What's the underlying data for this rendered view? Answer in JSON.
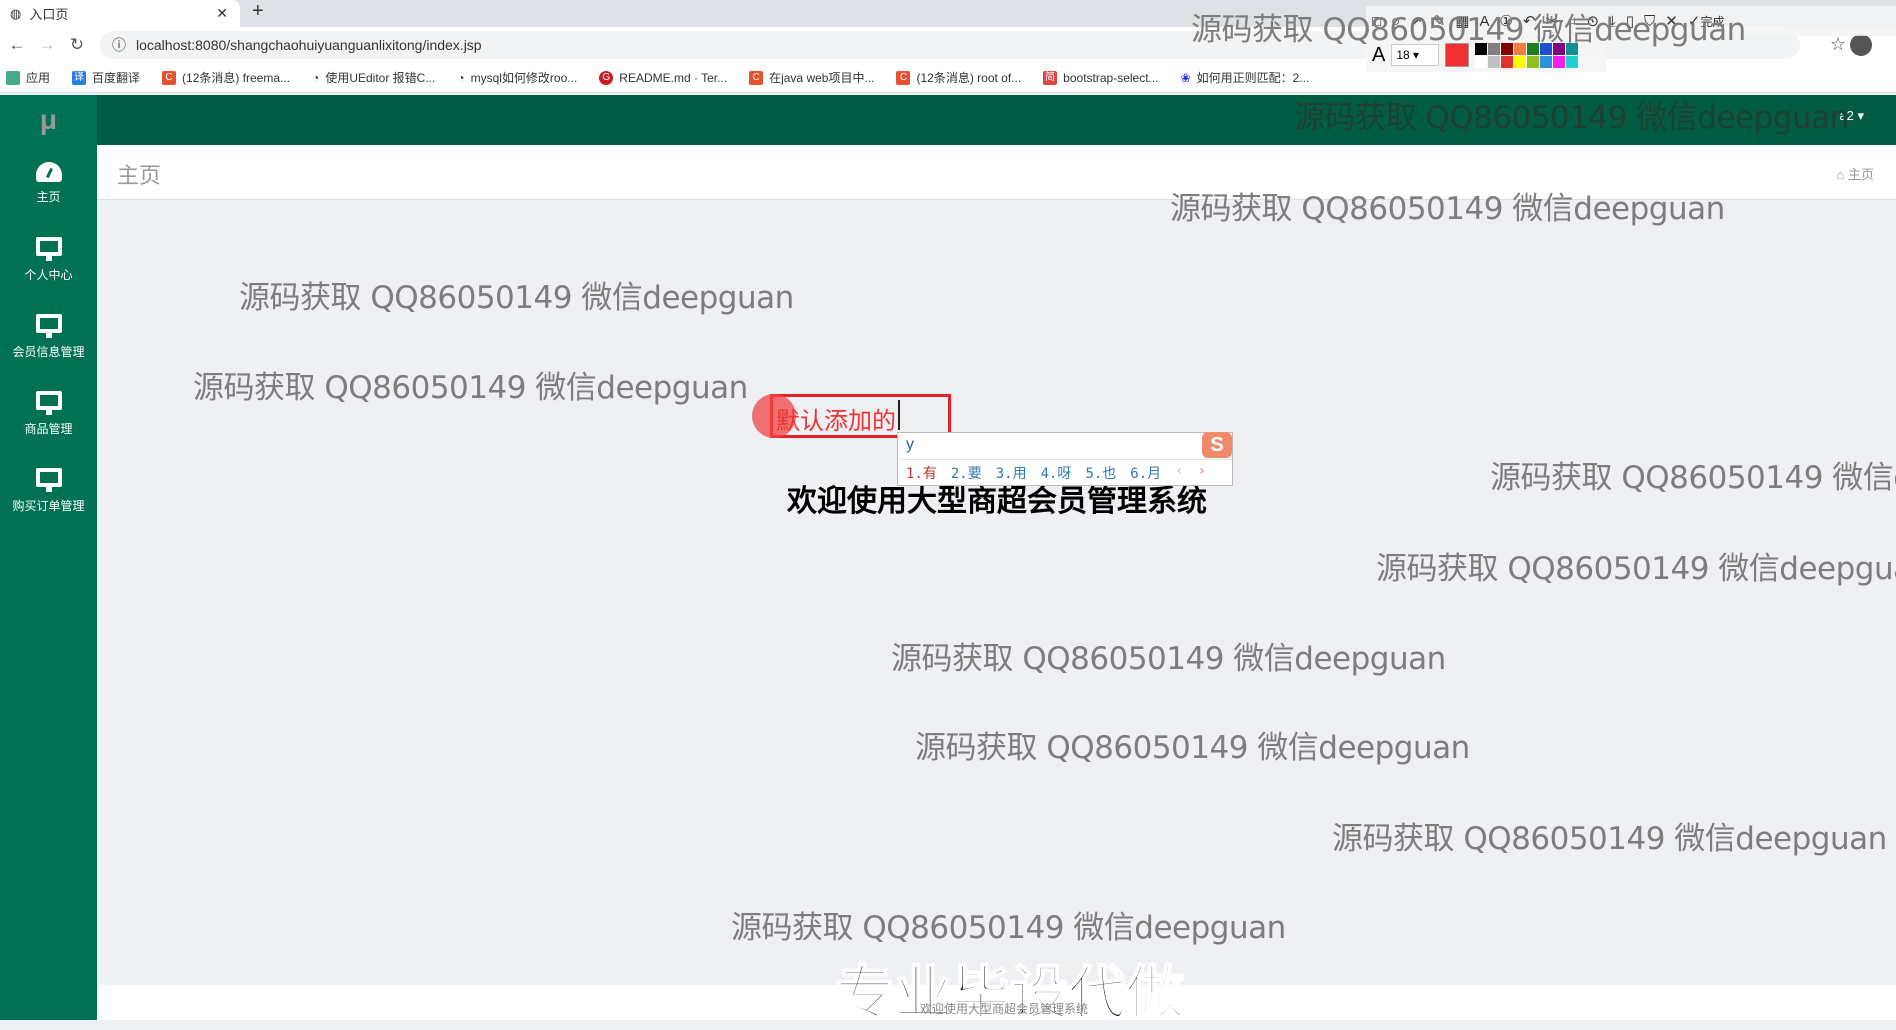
{
  "browser": {
    "tab_title": "入口页",
    "url": "localhost:8080/shangchaohuiyuanguanlixitong/index.jsp",
    "bookmarks": [
      "应用",
      "百度翻译",
      "(12条消息) freema...",
      "使用UEditor 报错C...",
      "mysql如何修改roo...",
      "README.md · Ter...",
      "在java web项目中...",
      "(12条消息) root of...",
      "bootstrap-select...",
      "如何用正则匹配：2..."
    ]
  },
  "screenshot_tool": {
    "font_size": "18",
    "done_label": "完成",
    "current_color": "#f03030",
    "palette": [
      "#000000",
      "#808080",
      "#800000",
      "#f08040",
      "#208020",
      "#2050d0",
      "#800080",
      "#109090",
      "#ffffff",
      "#c0c0c0",
      "#e03030",
      "#ffff00",
      "#90c020",
      "#3090e0",
      "#f020f0",
      "#20d0d0"
    ]
  },
  "app": {
    "logo": "μ",
    "user": "a2",
    "page_title": "主页",
    "breadcrumb": "主页",
    "sidebar": [
      {
        "label": "主页",
        "icon": "dashboard-icon"
      },
      {
        "label": "个人中心",
        "icon": "monitor-icon"
      },
      {
        "label": "会员信息管理",
        "icon": "monitor-icon"
      },
      {
        "label": "商品管理",
        "icon": "monitor-icon"
      },
      {
        "label": "购买订单管理",
        "icon": "monitor-icon"
      }
    ],
    "welcome": "欢迎使用大型商超会员管理系统",
    "footer": "欢迎使用大型商超会员管理系统",
    "accent": "#007152"
  },
  "annotation": {
    "text": "默认添加的"
  },
  "ime": {
    "input": "y",
    "candidates": [
      "1.有",
      "2.要",
      "3.用",
      "4.呀",
      "5.也",
      "6.月"
    ]
  },
  "watermark": "源码获取 QQ86050149 微信deepguan",
  "promo": "专业毕设代做"
}
